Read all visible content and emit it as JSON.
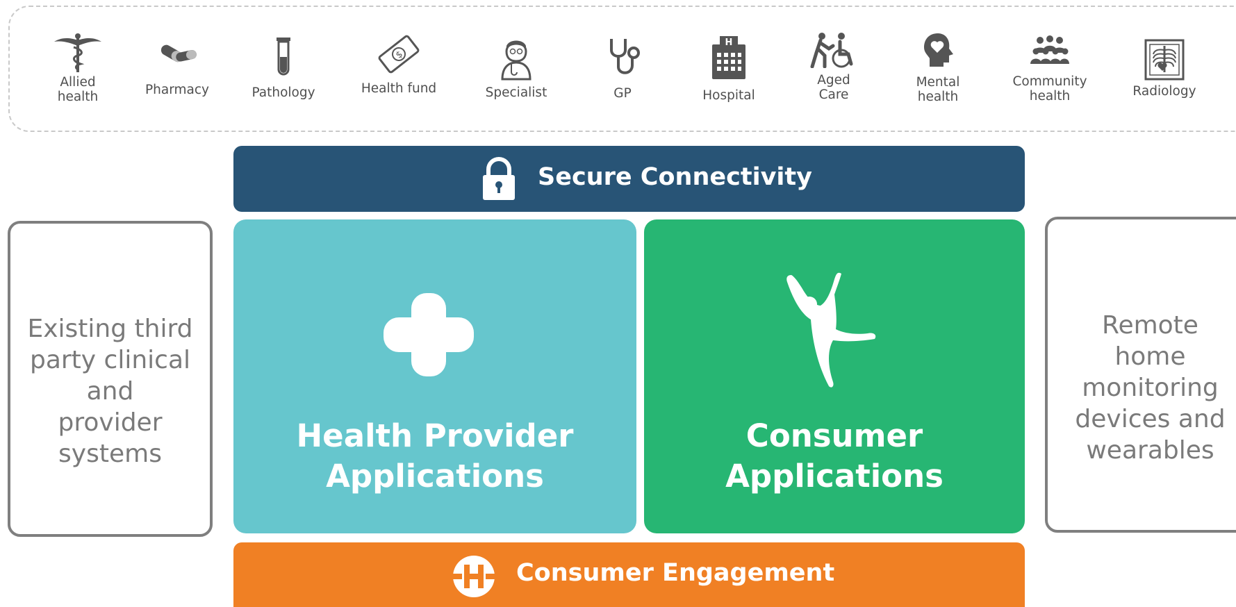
{
  "stakeholders": [
    {
      "label": "Allied\nhealth",
      "icon": "caduceus-icon"
    },
    {
      "label": "Pharmacy",
      "icon": "pills-icon"
    },
    {
      "label": "Pathology",
      "icon": "test-tube-icon"
    },
    {
      "label": "Health fund",
      "icon": "money-bill-icon"
    },
    {
      "label": "Specialist",
      "icon": "doctor-icon"
    },
    {
      "label": "GP",
      "icon": "stethoscope-icon"
    },
    {
      "label": "Hospital",
      "icon": "hospital-building-icon"
    },
    {
      "label": "Aged\nCare",
      "icon": "aged-care-icon"
    },
    {
      "label": "Mental\nhealth",
      "icon": "head-heart-icon"
    },
    {
      "label": "Community\nhealth",
      "icon": "people-group-icon"
    },
    {
      "label": "Radiology",
      "icon": "xray-icon"
    }
  ],
  "secure_connectivity": {
    "label": "Secure Connectivity",
    "icon": "padlock-icon",
    "color": "#285476"
  },
  "health_provider_panel": {
    "line1": "Health Provider",
    "line2": "Applications",
    "icon": "medical-cross-icon",
    "color": "#66c6cd"
  },
  "consumer_panel": {
    "line1": "Consumer",
    "line2": "Applications",
    "icon": "jumping-person-icon",
    "color": "#27b673"
  },
  "consumer_engagement": {
    "label": "Consumer Engagement",
    "icon": "engagement-logo-icon",
    "color": "#f08024"
  },
  "left_box": {
    "text": "Existing third\nparty clinical\nand\nprovider\nsystems"
  },
  "right_box": {
    "text": "Remote\nhome\nmonitoring\ndevices and\nwearables"
  }
}
